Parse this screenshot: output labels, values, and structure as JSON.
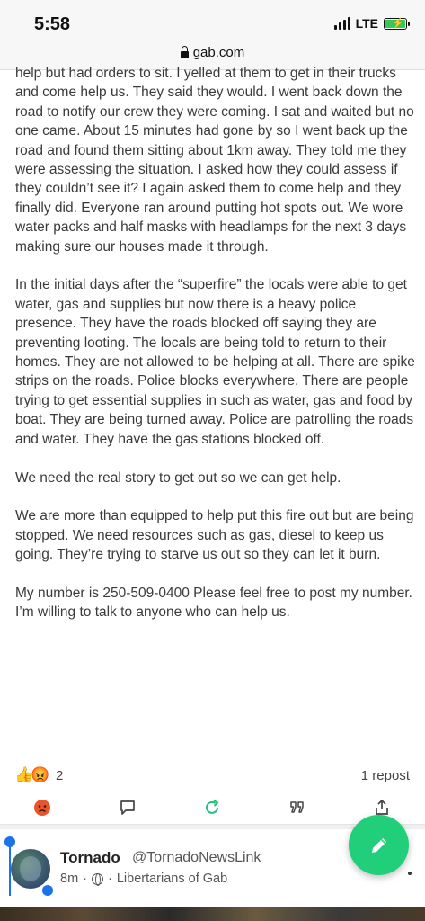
{
  "status_bar": {
    "time": "5:58",
    "network": "LTE"
  },
  "browser": {
    "url": "gab.com"
  },
  "post": {
    "paragraphs": [
      "help but had orders to sit. I yelled at them to get in their trucks and come help us. They said they would. I went back down the road to notify our crew they were coming. I sat and waited but no one came. About 15 minutes had gone by so I went back up the road and found them sitting about 1km away. They told me they were assessing the situation. I asked how they could assess if they couldn’t see it? I again asked them to come help and they finally did. Everyone ran around putting hot spots out. We wore water packs and half masks with headlamps for the next 3 days making sure our houses made it through.",
      "In the initial days after the “superfire” the locals were able to get water, gas and supplies but now there is a heavy police presence. They have the roads blocked off saying they are preventing looting. The locals are being told to return to their homes. They are not allowed to be helping at all. There are spike strips on the roads. Police blocks everywhere. There are people trying to get essential supplies in such as water, gas and food by boat. They are being turned away. Police are patrolling the roads and water. They have the gas stations blocked off.",
      "We need the real story to get out so we can get help.",
      "We are more than equipped to help put this fire out but are being stopped. We need resources such as gas, diesel to keep us going. They’re trying to starve us out so they can let it burn.",
      "My number is 250-509-0400 Please feel free to post my number. I’m willing to talk to anyone who can help us."
    ],
    "reaction_emojis": [
      "👍",
      "😡"
    ],
    "reaction_count": "2",
    "repost_count": "1 repost",
    "actions": [
      "react-icon",
      "comment-icon",
      "repost-icon",
      "quote-icon",
      "share-icon"
    ],
    "colors": {
      "accent": "#21cf7a",
      "repost": "#21c47a"
    }
  },
  "next_post": {
    "display_name": "Tornado",
    "handle": "@TornadoNewsLink",
    "time": "8m",
    "separator": "·",
    "group": "Libertarians of Gab"
  },
  "fab": {
    "icon": "pencil-icon"
  }
}
